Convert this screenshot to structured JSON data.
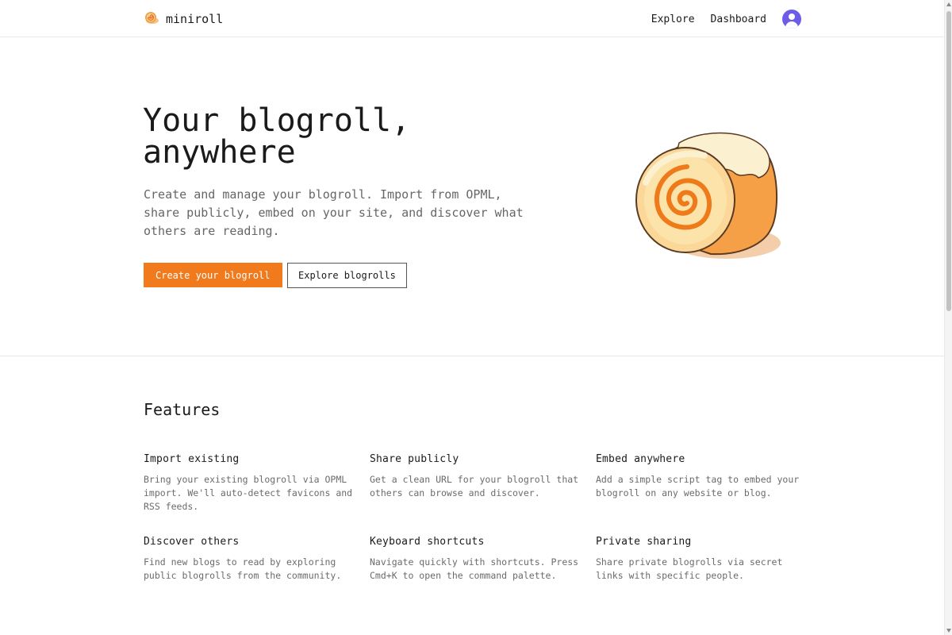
{
  "header": {
    "brand": "miniroll",
    "logo_icon": "cinnamon-roll-icon",
    "nav": [
      {
        "label": "Explore"
      },
      {
        "label": "Dashboard"
      }
    ],
    "avatar_icon": "user-avatar-icon"
  },
  "hero": {
    "title_line1": "Your blogroll,",
    "title_line2": "anywhere",
    "subtitle": "Create and manage your blogroll. Import from OPML, share publicly, embed on your site, and discover what others are reading.",
    "primary_button": "Create your blogroll",
    "secondary_button": "Explore blogrolls",
    "illustration": "swiss-roll-illustration"
  },
  "features": {
    "title": "Features",
    "items": [
      {
        "title": "Import existing",
        "description": "Bring your existing blogroll via OPML import. We'll auto-detect favicons and RSS feeds."
      },
      {
        "title": "Share publicly",
        "description": "Get a clean URL for your blogroll that others can browse and discover."
      },
      {
        "title": "Embed anywhere",
        "description": "Add a simple script tag to embed your blogroll on any website or blog."
      },
      {
        "title": "Discover others",
        "description": "Find new blogs to read by exploring public blogrolls from the community."
      },
      {
        "title": "Keyboard shortcuts",
        "description": "Navigate quickly with shortcuts. Press Cmd+K to open the command palette."
      },
      {
        "title": "Private sharing",
        "description": "Share private blogrolls via secret links with specific people."
      }
    ]
  },
  "colors": {
    "accent": "#f07a1c",
    "avatar": "#6c5ce7",
    "text": "#1a1a1a",
    "muted": "#6b6b6b"
  }
}
